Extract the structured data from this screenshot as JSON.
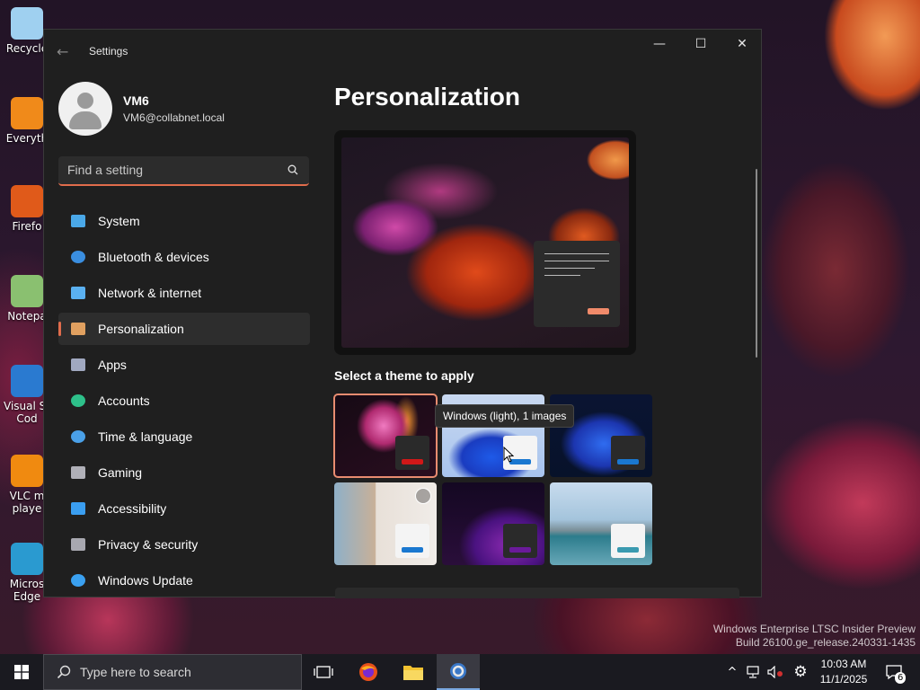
{
  "desktop": {
    "icons": [
      {
        "label": "Recycle",
        "color": "#9fd0f0"
      },
      {
        "label": "Everyth",
        "color": "#f08a1a"
      },
      {
        "label": "Firefo",
        "color": "#e05a1a"
      },
      {
        "label": "Notepa",
        "color": "#8ac070"
      },
      {
        "label": "Visual St\nCod",
        "color": "#2a7ad0"
      },
      {
        "label": "VLC m\nplaye",
        "color": "#f08a10"
      },
      {
        "label": "Micros\nEdge",
        "color": "#2a9ad0"
      }
    ]
  },
  "window": {
    "title": "Settings",
    "controls": {
      "minimize": "—",
      "maximize": "☐",
      "close": "✕"
    }
  },
  "profile": {
    "name": "VM6",
    "email": "VM6@collabnet.local"
  },
  "search": {
    "placeholder": "Find a setting"
  },
  "nav": {
    "items": [
      {
        "label": "System",
        "icon": "system-icon",
        "color": "#4aa8e8"
      },
      {
        "label": "Bluetooth & devices",
        "icon": "bluetooth-icon",
        "color": "#3a8ee0"
      },
      {
        "label": "Network & internet",
        "icon": "wifi-icon",
        "color": "#5ab0f0"
      },
      {
        "label": "Personalization",
        "icon": "brush-icon",
        "color": "#e0a060"
      },
      {
        "label": "Apps",
        "icon": "apps-icon",
        "color": "#a0a8c0"
      },
      {
        "label": "Accounts",
        "icon": "accounts-icon",
        "color": "#2ec08a"
      },
      {
        "label": "Time & language",
        "icon": "globe-icon",
        "color": "#4aa0e8"
      },
      {
        "label": "Gaming",
        "icon": "gamepad-icon",
        "color": "#b0b0b8"
      },
      {
        "label": "Accessibility",
        "icon": "accessibility-icon",
        "color": "#3a9ef0"
      },
      {
        "label": "Privacy & security",
        "icon": "shield-icon",
        "color": "#a8a8b0"
      },
      {
        "label": "Windows Update",
        "icon": "update-icon",
        "color": "#3aa0f0"
      }
    ],
    "active_index": 3,
    "accent": "#e06c4c"
  },
  "main": {
    "title": "Personalization",
    "section_label": "Select a theme to apply",
    "themes": [
      {
        "name": "glow",
        "selected": true,
        "tile_bar": "#d01818"
      },
      {
        "name": "windows-light",
        "selected": false,
        "tile_bar": "#1a78d0"
      },
      {
        "name": "windows-dark",
        "selected": false,
        "tile_bar": "#1a78d0"
      },
      {
        "name": "spotlight",
        "selected": false,
        "tile_bar": "#1a78d0"
      },
      {
        "name": "flow",
        "selected": false,
        "tile_bar": "#6a1a9a"
      },
      {
        "name": "captured-motion",
        "selected": false,
        "tile_bar": "#3a9ab0"
      }
    ],
    "tooltip": "Windows (light), 1 images"
  },
  "watermark": {
    "line1": "Windows        Enterprise LTSC Insider Preview",
    "line2": "Build 26100.ge_release.240331-1435"
  },
  "taskbar": {
    "search_placeholder": "Type here to search",
    "time": "10:03 AM",
    "date": "11/1/2025",
    "notification_count": "6"
  }
}
